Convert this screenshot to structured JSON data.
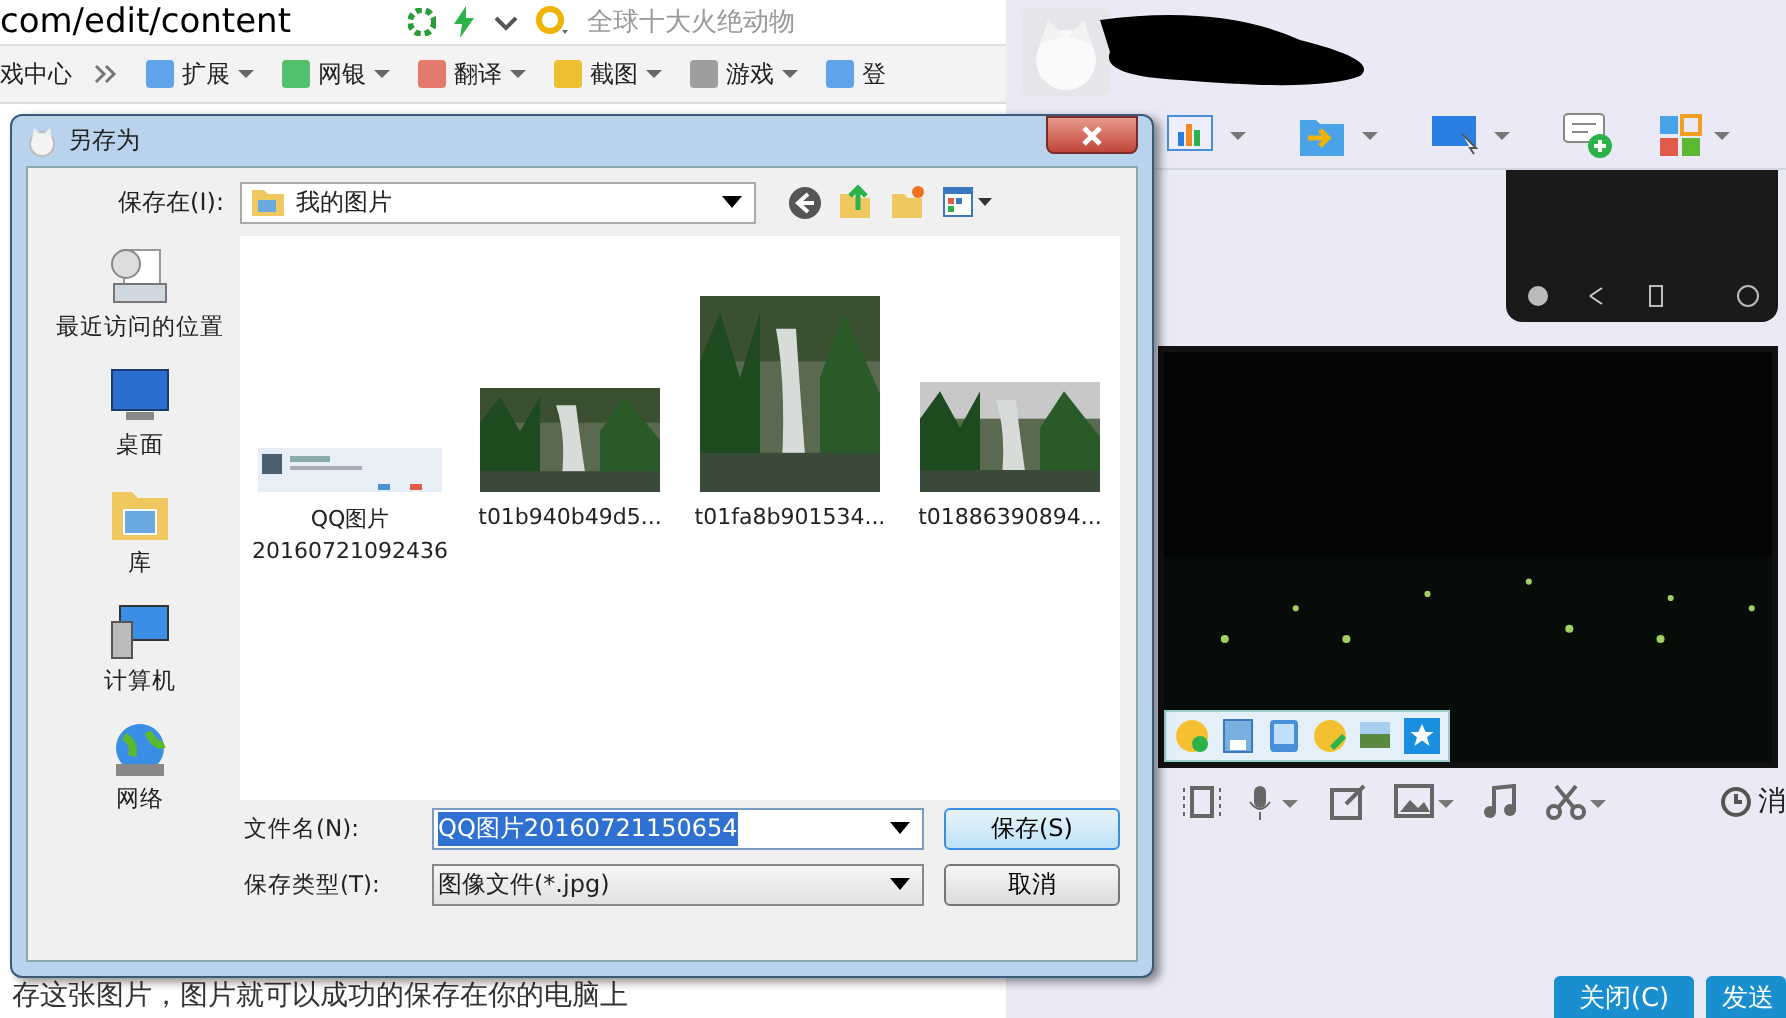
{
  "browser": {
    "address": "com/edit/content",
    "search": "全球十大火绝动物",
    "toolbar": [
      {
        "label": "戏中心"
      },
      {
        "label": "扩展"
      },
      {
        "label": "网银"
      },
      {
        "label": "翻译"
      },
      {
        "label": "截图"
      },
      {
        "label": "游戏"
      },
      {
        "label": "登"
      }
    ],
    "page_text": "存这张图片，图片就可以成功的保存在你的电脑上"
  },
  "dialog": {
    "title": "另存为",
    "save_in_label": "保存在(I):",
    "folder": "我的图片",
    "places": [
      {
        "label": "最近访问的位置"
      },
      {
        "label": "桌面"
      },
      {
        "label": "库"
      },
      {
        "label": "计算机"
      },
      {
        "label": "网络"
      }
    ],
    "files": [
      {
        "kind": "screenshot",
        "name_lines": [
          "QQ图片",
          "20160721092436"
        ]
      },
      {
        "name_lines": [
          "t01b940b49d5..."
        ]
      },
      {
        "name_lines": [
          "t01fa8b901534..."
        ]
      },
      {
        "name_lines": [
          "t01886390894..."
        ]
      }
    ],
    "filename_label": "文件名(N):",
    "filename": "QQ图片20160721150654",
    "filetype_label": "保存类型(T):",
    "filetype": "图像文件(*.jpg)",
    "buttons": [
      {
        "label": "保存(S)",
        "selected": true
      },
      {
        "label": "取消",
        "selected": false
      }
    ]
  },
  "chat": {
    "history": "消",
    "buttons": [
      "关闭(C)",
      "发送"
    ]
  }
}
